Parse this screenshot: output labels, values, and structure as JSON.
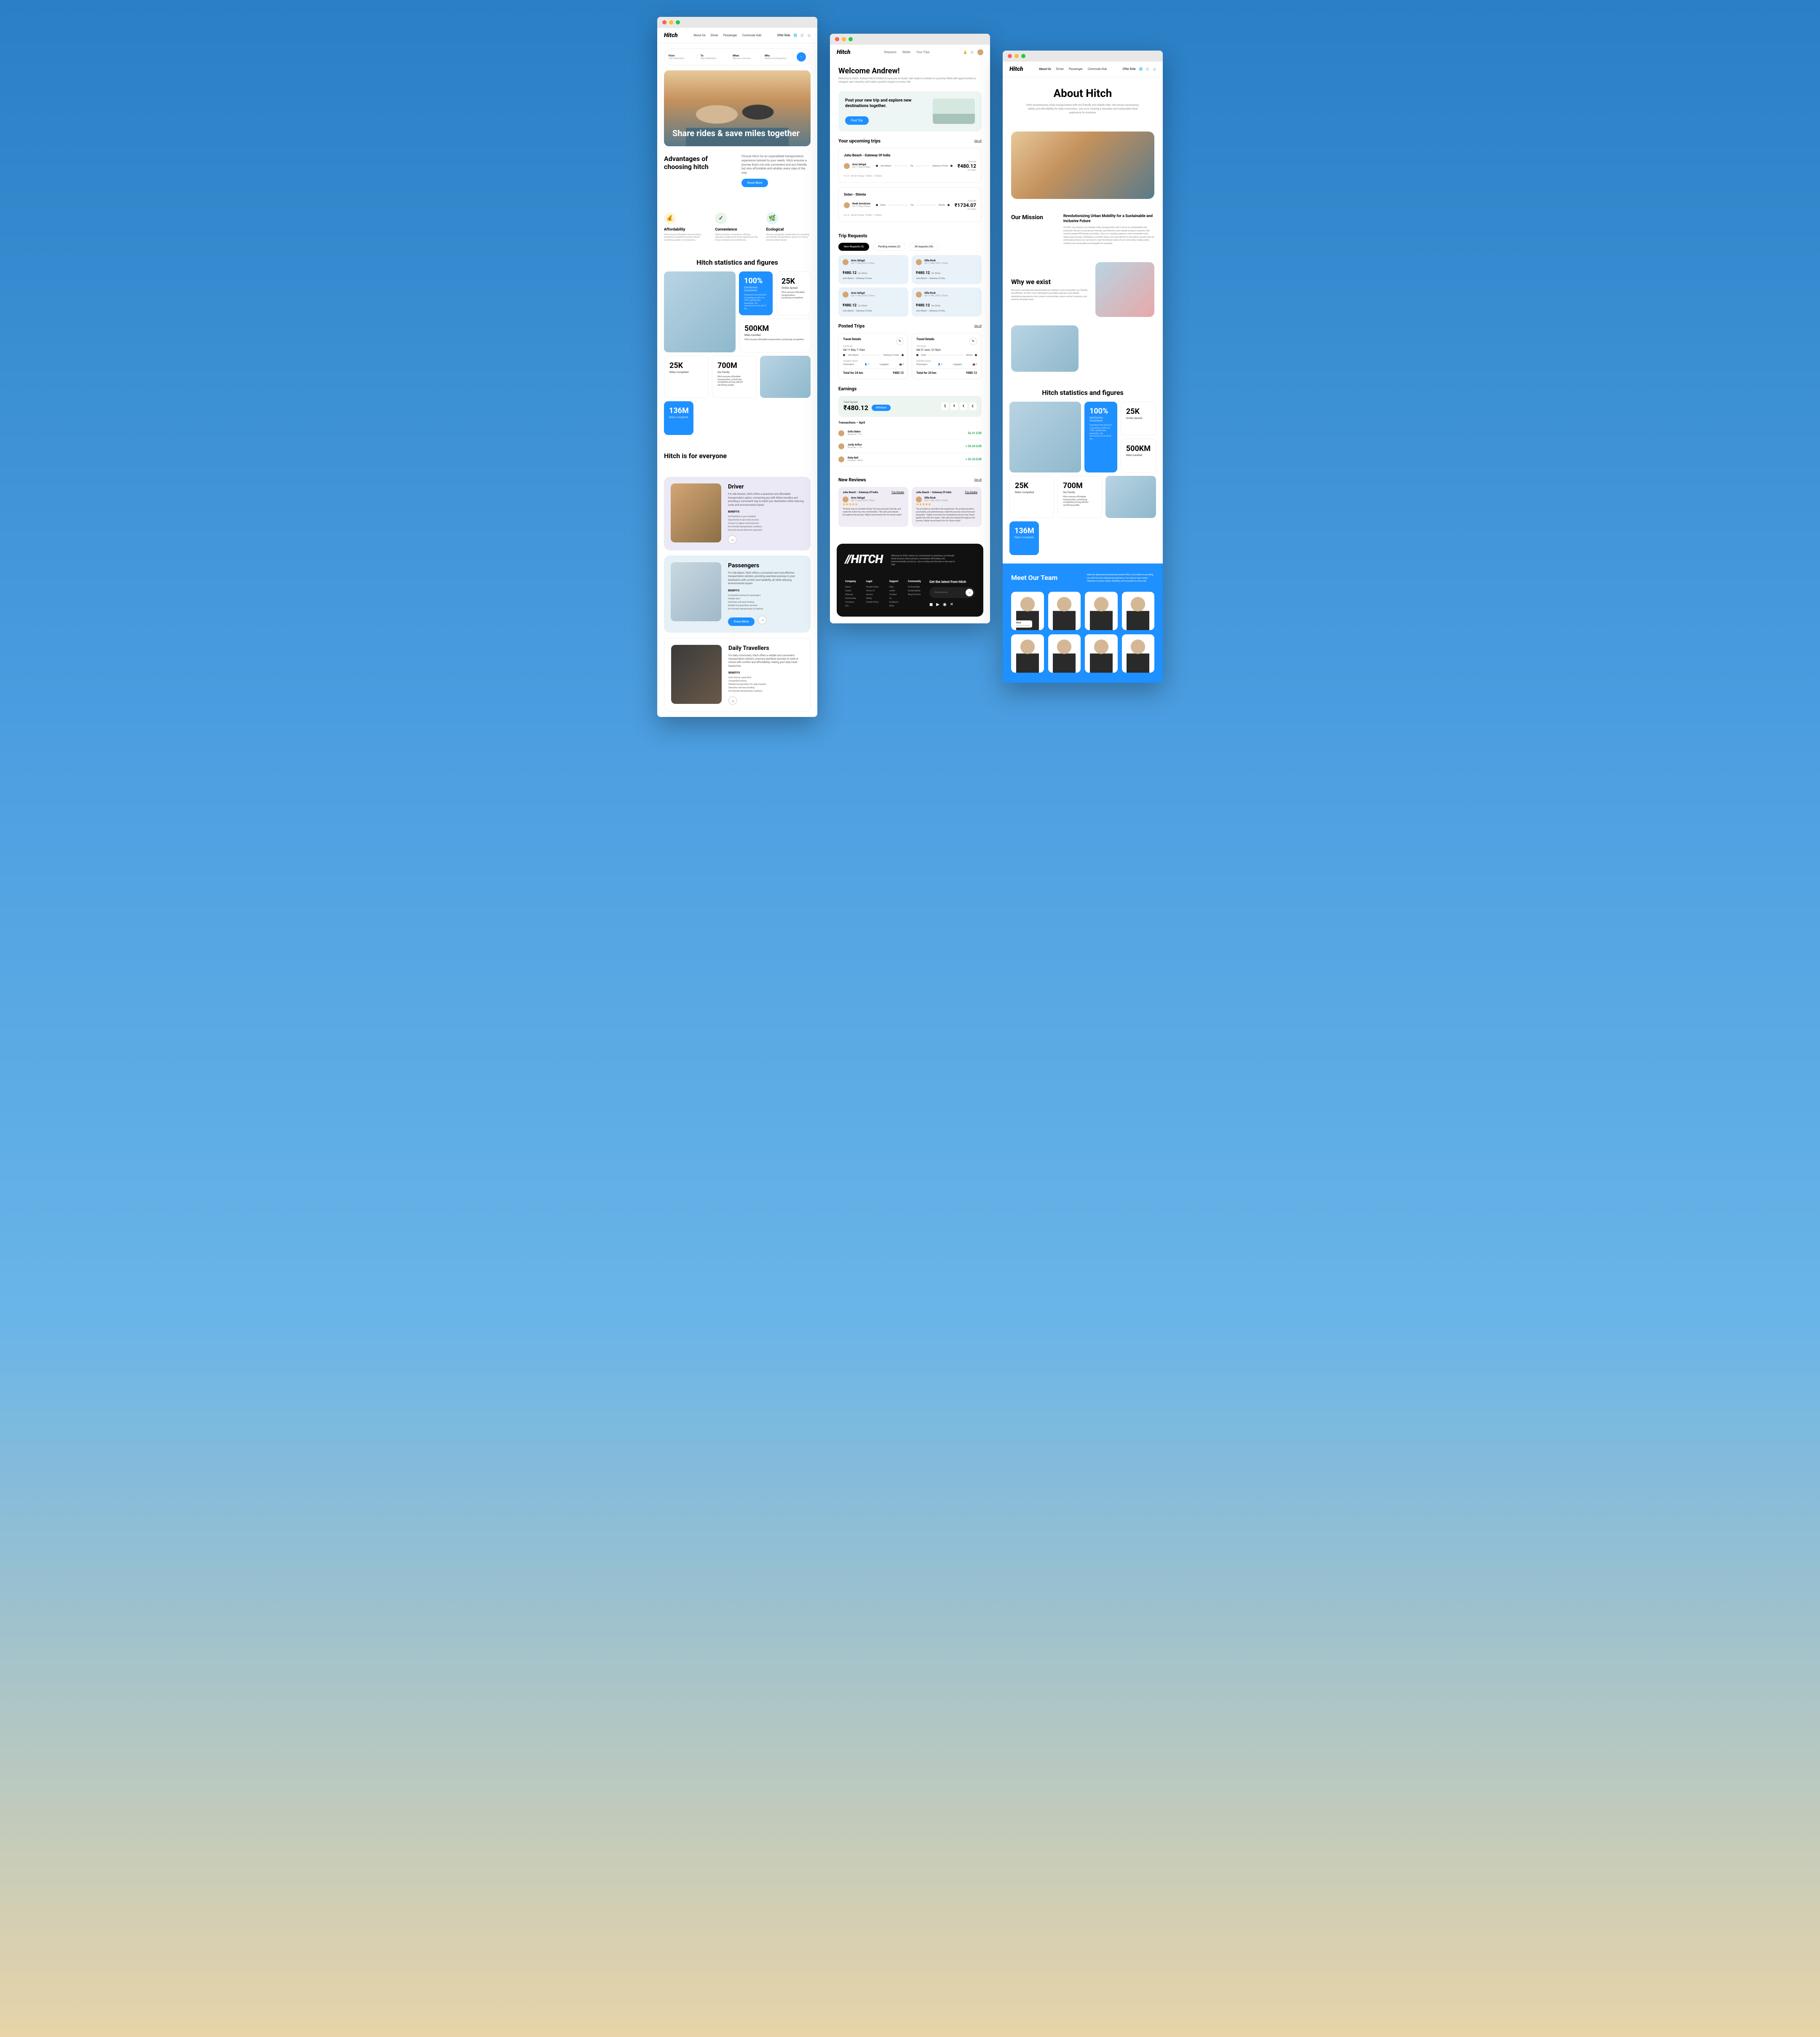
{
  "brand": "Hitch",
  "window1": {
    "nav": {
      "about": "About Us",
      "driver": "Driver",
      "passenger": "Passenger",
      "hub": "Commute Hub",
      "offer": "Offer Ride"
    },
    "search": {
      "from": {
        "label": "From",
        "sub": "Start destination"
      },
      "to": {
        "label": "To",
        "sub": "Start destination"
      },
      "when": {
        "label": "When",
        "sub": "Days you commute"
      },
      "who": {
        "label": "Who",
        "sub": "Guests you bring along"
      }
    },
    "hero": "Share rides & save miles together",
    "advantages": {
      "title": "Advantages of choosing hitch",
      "desc": "Choose Hitch for an unparalleled transportation experience tailored to your needs. Hitch ensures a journey that's not only convenient and eco-friendly but also affordable and reliable, every step of the way.",
      "btn": "Know More"
    },
    "features": [
      {
        "icon": "💰",
        "title": "Affordability",
        "desc": "Hitch ensures affordable transportation, prioritizing competitive pricing without sacrificing quality or convenience."
      },
      {
        "icon": "✓",
        "title": "Convenience",
        "desc": "Hitch prioritizes convenience, offering seamless booking and travel experiences that fit your schedule and preferences."
      },
      {
        "icon": "🌿",
        "title": "Ecological",
        "desc": "We are ecologically sustainable also providing eco-friendly transportation options to reduce environmental impact."
      }
    ],
    "stats_title": "Hitch statistics and figures",
    "stats": {
      "pct": {
        "num": "100%",
        "lbl": "Satisfaction Guaranteed",
        "desc": "Experience the pinnacle of excellence with our 100% satisfaction guarantee. Our commitment is to all of the…"
      },
      "smiles": {
        "num": "25K",
        "lbl": "Smiles Spread",
        "desc": "Hitch ensures affordable transportation, prioritizing competitive."
      },
      "miles": {
        "num": "500KM",
        "lbl": "Miles travelled",
        "desc": "Hitch ensures affordable transportation, prioritizing competitive."
      },
      "rides1": {
        "num": "25K",
        "lbl": "Rides Completed",
        "desc": "Hitch ensures."
      },
      "users": {
        "num": "700M",
        "lbl": "Our Family",
        "desc": "Hitch ensures affordable transportation, prioritizing competitive pricing without sacrificing quality."
      },
      "rides2": {
        "num": "136M",
        "lbl": "Rides Completed",
        "desc": "Hitch ensures."
      }
    },
    "everyone_title": "Hitch is for everyone",
    "personas": {
      "driver": {
        "title": "Driver",
        "desc": "For ride-sharers, Hitch offers a seamless and affordable transportation option, connecting you with fellow travelers and providing a convenient way to reach your destination while reducing costs and environmental impact.",
        "benefits_label": "BENEFITS",
        "benefits": [
          "Get flexibility in your schedule",
          "Opportunity to earn extra income",
          "Access to support and resources",
          "Eco-friendly transportation solutions",
          "Fast and secure electronic payments"
        ]
      },
      "passengers": {
        "title": "Passengers",
        "desc": "For ride-takers, Hitch offers a convenient and cost-effective transportation solution, providing seamless journeys to your destination with comfort and reliability, all while reducing environmental impact.",
        "benefits_label": "BENEFITS",
        "benefits": [
          "Competitive pricing for passengers",
          "Flexible time",
          "Seamless and easy booking",
          "Reliable transportation services",
          "Eco-friendly transportation of/options"
        ],
        "btn": "Know More"
      },
      "daily": {
        "title": "Daily Travellers",
        "desc": "For daily commuters, Hitch offers a reliable and convenient transportation solution, ensuring seamless journeys to work or school with comfort and affordability, making your daily travel hassle-free.",
        "benefits_label": "BENEFITS",
        "benefits": [
          "Save time by using Hitch",
          "Competitive pricing",
          "Reliable transportation for daily travelers",
          "Seamless and easy booking",
          "Eco-friendly transportation solutions"
        ]
      }
    }
  },
  "window2": {
    "nav": {
      "requests": "Requests",
      "wallet": "Wallet",
      "trips": "Your Trips"
    },
    "welcome": {
      "title": "Welcome Andrew!",
      "sub": "Welcome to Hitch, Andrew! We're thrilled to have you on board. Get ready to embark on a journey filled with opportunities to navigate, earn rewards, and make a positive impact on every ride."
    },
    "promo": {
      "title": "Post your new trip and explore new destinations together.",
      "btn": "Post Trip"
    },
    "upcoming": {
      "title": "Your upcoming trips",
      "see": "See all"
    },
    "trips": [
      {
        "route": "Juhu Beach - Gateway Of India",
        "person": "Arun Sehgal",
        "date": "Sat 11 May, 8:30am",
        "from": "Juhu Beach",
        "to": "Gateway of India",
        "via": "Via",
        "price_lbl": "You'll get",
        "price": "₹480.12",
        "meta": "4.2 ★ · Arrival Timing - 8:30am ~ 9:00am",
        "dist": "for 24km"
      },
      {
        "route": "Solan - Shimla",
        "person": "Noah Armstrum",
        "date": "Sat 11 May, 8:30am",
        "from": "Solan",
        "to": "Shimla",
        "via": "Via",
        "price_lbl": "You'll get",
        "price": "₹1734.07",
        "meta": "4.2 ★ · Arrival Timing - 8:30am ~ 9:00am",
        "dist": "for 24km"
      }
    ],
    "requests": {
      "title": "Trip Requests",
      "pills": [
        "New Requests (4)",
        "Pending reviews (2)",
        "All requests (24)"
      ],
      "cards": [
        {
          "name": "Arun Sehgal",
          "date": "Sat 11 May 2024, 5:30am",
          "price": "₹480.12",
          "dist": "for 24 km",
          "route": "Juhu Beach – Gateway of India"
        },
        {
          "name": "Ollie Rock",
          "date": "Sat 11 May 2024, 5:30am",
          "price": "₹480.12",
          "dist": "for 24 km",
          "route": "Juhu Beach – Gateway of India"
        },
        {
          "name": "Arun Sehgal",
          "date": "Sat 11 May 2024, 5:30am",
          "price": "₹480.12",
          "dist": "for 24 km",
          "route": "Juhu Beach – Gateway of India"
        },
        {
          "name": "Ollie Rock",
          "date": "Sat 11 May 2024, 5:30am",
          "price": "₹480.12",
          "dist": "for 24 km",
          "route": "Juhu Beach – Gateway of India"
        }
      ]
    },
    "posted": {
      "title": "Posted Trips",
      "see": "See all",
      "cards": [
        {
          "title": "Travel Details",
          "route_lbl": "Trip Route",
          "route_date": "Sat 11 May, 7:15am",
          "from": "Juhu Beach",
          "to": "Gateway of India",
          "space_lbl": "Available Space",
          "pass": "Passengers",
          "pass_v": "5",
          "lug": "Luggages",
          "lug_v": "3",
          "total_lbl": "Total for 24 km",
          "total": "₹480.12"
        },
        {
          "title": "Travel Details",
          "route_lbl": "Trip Route",
          "route_date": "Sat 27 June, 12:15pm",
          "from": "Solan",
          "to": "Shimla",
          "space_lbl": "Available Space",
          "pass": "Passengers",
          "pass_v": "5",
          "lug": "Luggages",
          "lug_v": "3",
          "total_lbl": "Total for 24 km",
          "total": "₹480.12"
        }
      ]
    },
    "earnings": {
      "title": "Earnings",
      "total_lbl": "Total Earned",
      "total": "₹480.12",
      "withdraw": "Withdraw",
      "currencies": [
        "$",
        "₹",
        "€",
        "£"
      ],
      "trans_title": "Transactions – April",
      "trans": [
        {
          "name": "Sofia Baker",
          "sub": "Received • 11m",
          "amt": "56.41 EUR"
        },
        {
          "name": "Jordy Arthur",
          "sub": "Received • 11m",
          "amt": "+ 30.60 EUR"
        },
        {
          "name": "Ruby Bell",
          "sub": "Received • Mar6",
          "amt": "+ 56.30 EUR"
        }
      ]
    },
    "reviews": {
      "title": "New Reviews",
      "see": "See all",
      "cards": [
        {
          "route": "Juhu Beach – Gateway Of India",
          "link": "Trip Details",
          "name": "Arun Sehgal",
          "date": "Sat 11 May 2024, 5:30am",
          "stars": "★★★★★",
          "text": "\"Andrew was an excellent driver! He was punctual, friendly, and made the entire trip very comfortable. I felt safe and relaxed throughout the journey. Highly recommend him for future rides!\""
        },
        {
          "route": "Juhu Beach – Gateway Of India",
          "link": "Trip Details",
          "name": "Ollie Rock",
          "date": "Sat 11 May 2024, 5:30am",
          "stars": "★★★★★",
          "text": "\"He provided an excellent ride experience. His professionalism, punctuality, and attentiveness made the journey stress-free and enjoyable. I highly commend his exceptional service and would gladly ride with him again. I felt safe and relaxed throughout the journey. Highly recommend him for future rides!\""
        }
      ]
    },
    "footer": {
      "logo": "//HITCH",
      "tag": "Welcome to Hitch, where our commitment to seamless, eco-friendly travel ensures every journey is convenient, affordable, and environmentally conscious. Join us today and discover a new way to ride!",
      "cols": [
        {
          "h": "Company",
          "items": [
            "About",
            "Career",
            "Sitemap",
            "Partnership",
            "Company Info"
          ]
        },
        {
          "h": "Legal",
          "items": [
            "Private Policy",
            "Terms of service",
            "Safety",
            "Cookie Policy"
          ]
        },
        {
          "h": "Support",
          "items": [
            "Help center",
            "Contact Us",
            "Feedback",
            "FAQs"
          ]
        },
        {
          "h": "Community",
          "items": [
            "Partnerships",
            "Sustainability",
            "Blog & Events"
          ]
        }
      ],
      "newsletter": {
        "title": "Get the latest from hitch",
        "placeholder": "Email address"
      }
    }
  },
  "window3": {
    "nav": {
      "about": "About Us",
      "driver": "Driver",
      "passenger": "Passenger",
      "hub": "Commute Hub",
      "offer": "Offer Ride"
    },
    "hero": {
      "title": "About Hitch",
      "sub": "Hitch revolutionizes urban transportation with eco-friendly and reliable rides. We ensure convenience, safety, and affordability for daily commuters. Join us in creating a seamless and sustainable travel experience for everyone."
    },
    "mission": {
      "h": "Our Mission",
      "title": "Revolutionizing Urban Mobility for a Sustainable and Inclusive Future",
      "body": "At Hitch, our mission is to reshape urban transportation with a focus on sustainability and inclusivity. We aim to provide eco-friendly, cost-effective, and reliable transport solutions that connect people effortlessly and safely. Join us in creating a greener, more connected world, where every journey contributes to a better future. Our commitment to innovation ensures that we continually enhance our services to meet the diverse needs of our community, making urban mobility more accessible and enjoyable for everyone."
    },
    "why": {
      "title": "Why we exist",
      "body": "We exist to revolutionize transportation by making it more accessible, eco-friendly, and efficient. At Hitch, we're dedicated to providing seamless and reliable ridesharing experiences that connect communities, reduce carbon footprints, and enhance everyday travel."
    },
    "stats_title": "Hitch statistics and figures",
    "team": {
      "title": "Meet Our Team",
      "sub": "Meet the dedicated professionals behind Hitch, committed to providing you with the best ridesharing experience. Our diverse team works tirelessly to ensure safety, reliability, and innovation in every ride.",
      "member": {
        "name": "Nizol",
        "role": "Software Engineer"
      }
    }
  }
}
